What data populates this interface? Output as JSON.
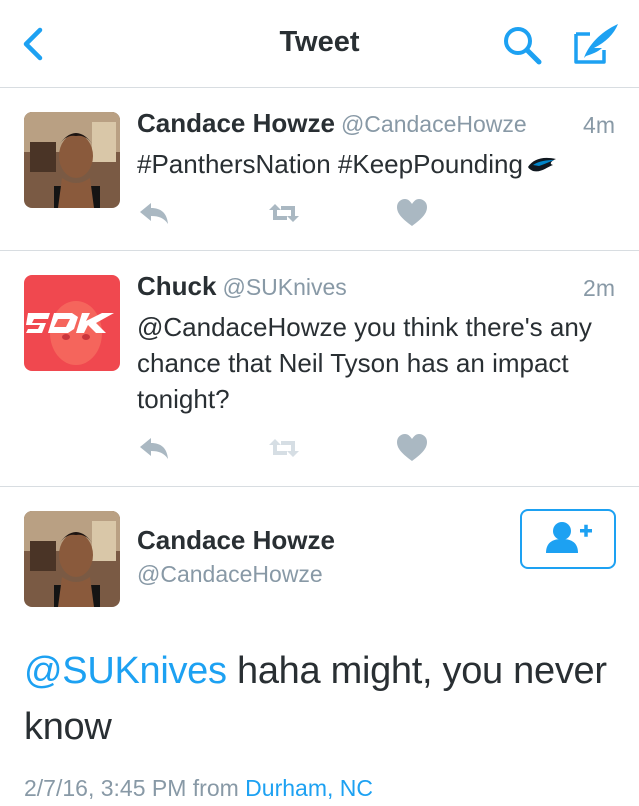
{
  "nav": {
    "title": "Tweet",
    "back_icon": "chevron-left-icon",
    "search_icon": "search-icon",
    "compose_icon": "compose-icon",
    "accent": "#1da1f2"
  },
  "tweets": [
    {
      "name": "Candace Howze",
      "handle": "@CandaceHowze",
      "time": "4m",
      "text": "#PanthersNation #KeepPounding",
      "emoji_icon": "panthers-logo-icon"
    },
    {
      "name": "Chuck",
      "handle": "@SUKnives",
      "time": "2m",
      "text": "@CandaceHowze you think there's any chance that Neil Tyson has an impact tonight?",
      "avatar_text": "SDK",
      "avatar_color": "#f0484f"
    }
  ],
  "main_tweet": {
    "name": "Candace Howze",
    "handle": "@CandaceHowze",
    "mention": "@SUKnives",
    "text": " haha might, you never know",
    "timestamp": "2/7/16, 3:45 PM from",
    "location": "Durham, NC",
    "follow_icon": "add-user-icon"
  },
  "colors": {
    "text": "#292f33",
    "secondary": "#8899a6",
    "action_icon": "#aab8c2",
    "divider": "#d8dde1"
  }
}
